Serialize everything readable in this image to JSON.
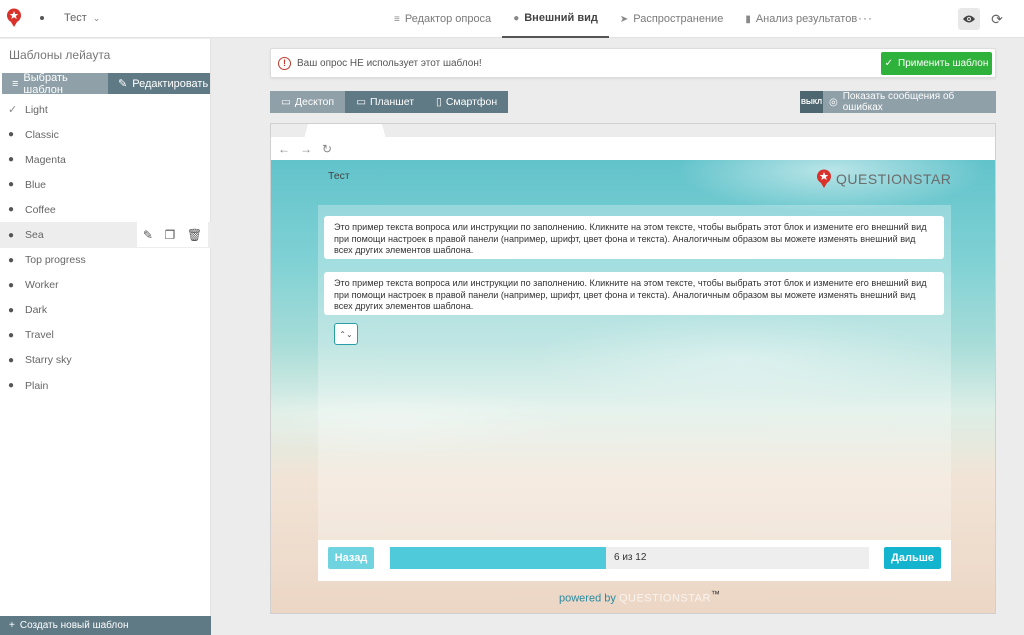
{
  "app": {
    "project_name": "Тест",
    "more_label": "···"
  },
  "nav": {
    "items": [
      {
        "label": "Редактор опроса",
        "icon": "editor-icon",
        "active": false
      },
      {
        "label": "Внешний вид",
        "icon": "palette-icon",
        "active": true
      },
      {
        "label": "Распространение",
        "icon": "send-icon",
        "active": false
      },
      {
        "label": "Анализ результатов",
        "icon": "bar-chart-icon",
        "active": false
      }
    ]
  },
  "sidebar": {
    "title": "Шаблоны лейаута",
    "tab_choose": "Выбрать шаблон",
    "tab_edit": "Редактировать",
    "templates": [
      {
        "label": "Light",
        "checked": true
      },
      {
        "label": "Classic"
      },
      {
        "label": "Magenta"
      },
      {
        "label": "Blue"
      },
      {
        "label": "Coffee"
      },
      {
        "label": "Sea",
        "selected": true
      },
      {
        "label": "Top progress"
      },
      {
        "label": "Worker"
      },
      {
        "label": "Dark"
      },
      {
        "label": "Travel"
      },
      {
        "label": "Starry sky"
      },
      {
        "label": "Plain"
      }
    ],
    "create_label": "Создать новый шаблон"
  },
  "warning": {
    "text": "Ваш опрос НЕ использует этот шаблон!",
    "apply_label": "Применить шаблон"
  },
  "devices": {
    "desktop": "Десктоп",
    "tablet": "Планшет",
    "phone": "Смартфон"
  },
  "errors": {
    "toggle": "ВЫКЛ",
    "label": "Показать сообщения об ошибках"
  },
  "preview": {
    "survey_title": "Тест",
    "brand": "QUESTIONSTAR",
    "question_text": "Это пример текста вопроса или инструкции по заполнению. Кликните на этом тексте, чтобы выбрать этот блок и измените его внешний вид при помощи настроек в правой панели (например, шрифт, цвет фона и текста). Аналогичным образом вы можете изменять внешний вид всех других элементов шаблона.",
    "back_label": "Назад",
    "next_label": "Дальше",
    "progress_text": "6 из 12",
    "progress_current": 6,
    "progress_total": 12,
    "powered_by": "powered by",
    "powered_brand": "QUESTIONSTAR",
    "trademark": "™"
  },
  "colors": {
    "accent_green": "#2fb23b",
    "slate": "#607a85",
    "progress": "#4fcadb",
    "next_button": "#14b4cf",
    "brand_red": "#d9322b"
  }
}
